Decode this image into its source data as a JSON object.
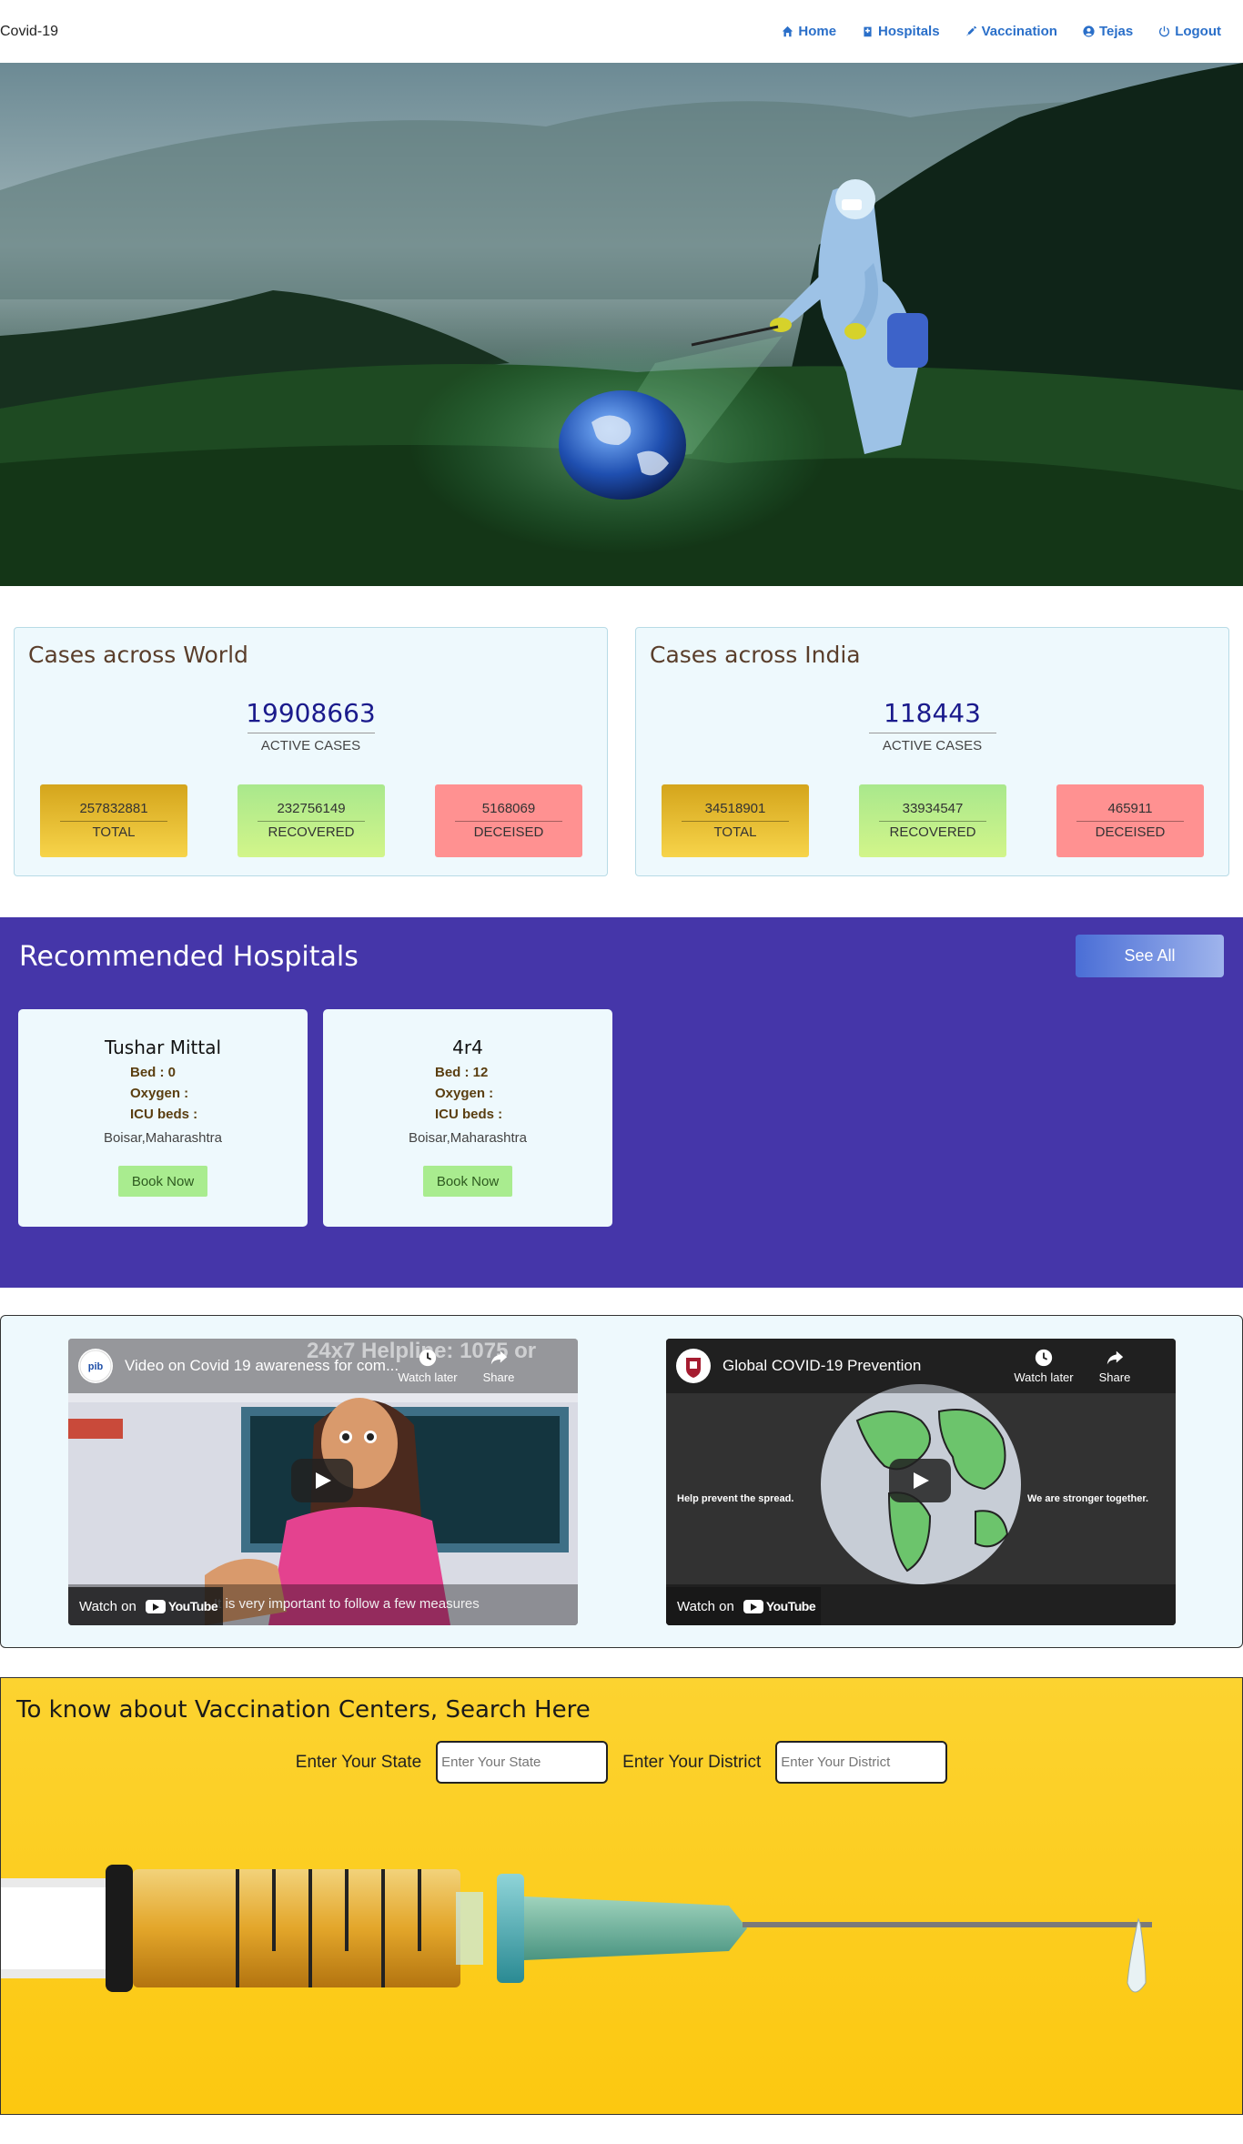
{
  "navbar": {
    "brand": "Covid-19",
    "links": [
      {
        "label": "Home",
        "icon": "home-icon"
      },
      {
        "label": "Hospitals",
        "icon": "hospital-icon"
      },
      {
        "label": "Vaccination",
        "icon": "syringe-icon"
      },
      {
        "label": "Tejas",
        "icon": "user-circle-icon"
      },
      {
        "label": "Logout",
        "icon": "power-icon"
      }
    ]
  },
  "world": {
    "title": "Cases across World",
    "active": "19908663",
    "active_label": "ACTIVE CASES",
    "total": "257832881",
    "total_label": "TOTAL",
    "recovered": "232756149",
    "recovered_label": "RECOVERED",
    "deceased": "5168069",
    "deceased_label": "DECEISED"
  },
  "india": {
    "title": "Cases across India",
    "active": "118443",
    "active_label": "ACTIVE CASES",
    "total": "34518901",
    "total_label": "TOTAL",
    "recovered": "33934547",
    "recovered_label": "RECOVERED",
    "deceased": "465911",
    "deceased_label": "DECEISED"
  },
  "hospitals": {
    "title": "Recommended Hospitals",
    "see_all": "See All",
    "cards": [
      {
        "name": "Tushar Mittal",
        "bed": "Bed : 0",
        "oxygen": "Oxygen :",
        "icu": "ICU beds :",
        "location": "Boisar,Maharashtra",
        "book": "Book Now"
      },
      {
        "name": "4r4",
        "bed": "Bed : 12",
        "oxygen": "Oxygen :",
        "icu": "ICU beds :",
        "location": "Boisar,Maharashtra",
        "book": "Book Now"
      }
    ]
  },
  "videos": [
    {
      "title": "Video on Covid 19 awareness for com...",
      "watch_later": "Watch later",
      "share": "Share",
      "watch_on": "Watch on",
      "youtube": "YouTube",
      "overlay_top": "24x7 Helpline: 1075 or",
      "caption": "It is very important to follow a few measures"
    },
    {
      "title": "Global COVID-19 Prevention",
      "watch_later": "Watch later",
      "share": "Share",
      "watch_on": "Watch on",
      "youtube": "YouTube",
      "left_text": "Help prevent the spread.",
      "right_text": "We are stronger together."
    }
  ],
  "vaccination": {
    "title": "To know about Vaccination Centers, Search Here",
    "state_label": "Enter Your State",
    "state_placeholder": "Enter Your State",
    "district_label": "Enter Your District",
    "district_placeholder": "Enter Your District"
  },
  "colors": {
    "nav_link": "#2a6fc9",
    "hospitals_bg": "#4536a9",
    "card_bg": "#eef9fd",
    "vacc_bg": "#fcd330"
  }
}
